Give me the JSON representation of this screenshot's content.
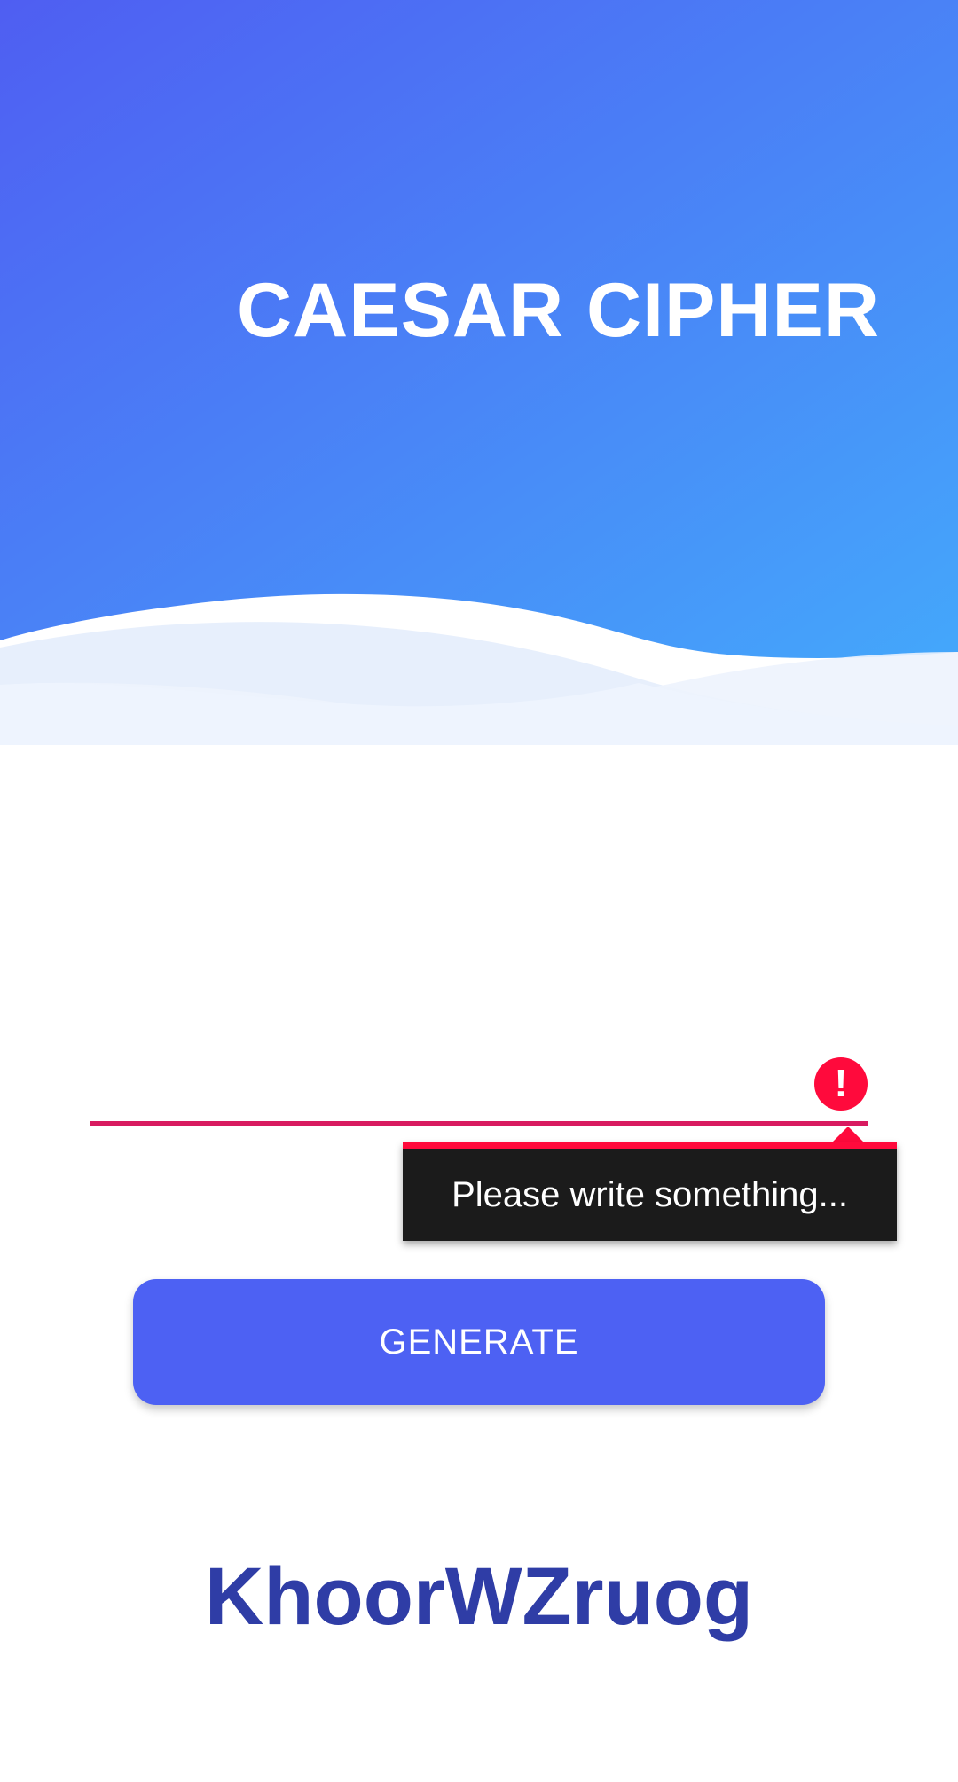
{
  "header": {
    "title": "CAESAR CIPHER",
    "gradient_start": "#4f5ef2",
    "gradient_end": "#44a7fb"
  },
  "input": {
    "value": "",
    "placeholder": "",
    "underline_color": "#d81b60",
    "error_icon": "exclamation-icon",
    "error_color": "#ff0a3c"
  },
  "error_popup": {
    "message": "Please write something..."
  },
  "actions": {
    "generate_label": "GENERATE",
    "button_color": "#4d61f3"
  },
  "result": {
    "text": "KhoorWZruog",
    "color": "#2f3da6"
  }
}
